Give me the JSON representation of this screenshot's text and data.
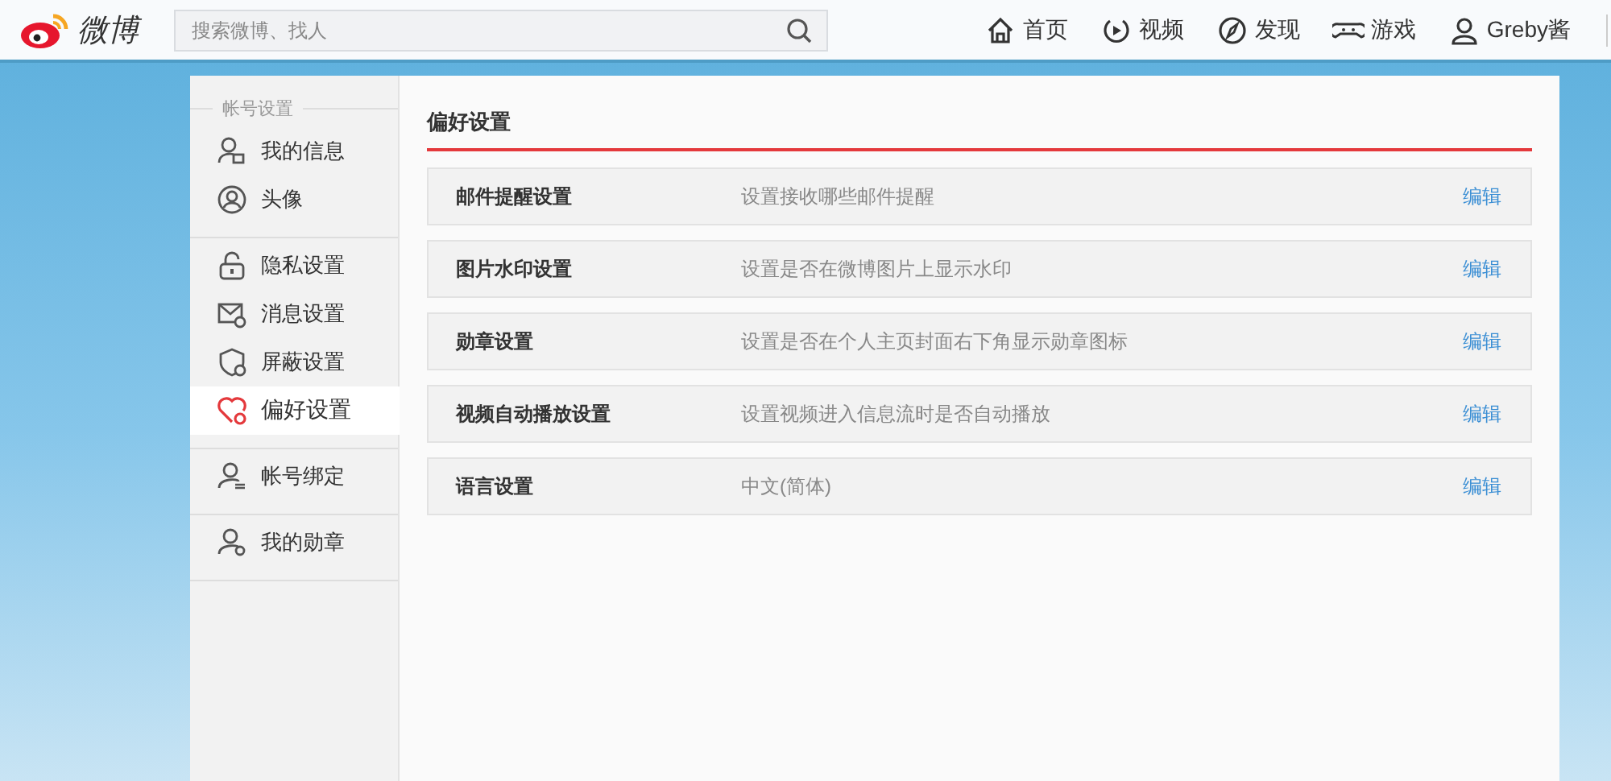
{
  "header": {
    "logo_text": "微博",
    "search": {
      "placeholder": "搜索微博、找人"
    },
    "nav": [
      {
        "label": "首页"
      },
      {
        "label": "视频"
      },
      {
        "label": "发现"
      },
      {
        "label": "游戏"
      },
      {
        "label": "Greby酱"
      }
    ]
  },
  "sidebar": {
    "groups": [
      {
        "label": "帐号设置",
        "items": [
          {
            "label": "我的信息",
            "selected": false
          },
          {
            "label": "头像",
            "selected": false
          }
        ]
      },
      {
        "items": [
          {
            "label": "隐私设置",
            "selected": false
          },
          {
            "label": "消息设置",
            "selected": false
          },
          {
            "label": "屏蔽设置",
            "selected": false
          },
          {
            "label": "偏好设置",
            "selected": true
          }
        ]
      },
      {
        "items": [
          {
            "label": "帐号绑定",
            "selected": false
          }
        ]
      },
      {
        "items": [
          {
            "label": "我的勋章",
            "selected": false
          }
        ]
      }
    ]
  },
  "main": {
    "title": "偏好设置",
    "rows": [
      {
        "name": "邮件提醒设置",
        "description": "设置接收哪些邮件提醒",
        "action": "编辑"
      },
      {
        "name": "图片水印设置",
        "description": "设置是否在微博图片上显示水印",
        "action": "编辑"
      },
      {
        "name": "勋章设置",
        "description": "设置是否在个人主页封面右下角显示勋章图标",
        "action": "编辑"
      },
      {
        "name": "视频自动播放设置",
        "description": "设置视频进入信息流时是否自动播放",
        "action": "编辑"
      },
      {
        "name": "语言设置",
        "description": "中文(简体)",
        "action": "编辑"
      }
    ]
  }
}
